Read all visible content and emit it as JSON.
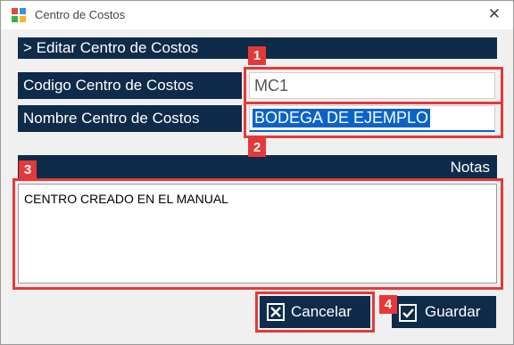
{
  "window": {
    "title": "Centro de Costos",
    "close_icon": "close-icon"
  },
  "section": {
    "header": "> Editar Centro de Costos"
  },
  "form": {
    "codigo_label": "Codigo Centro de Costos",
    "codigo_value": "MC1",
    "nombre_label": "Nombre Centro de Costos",
    "nombre_value": "BODEGA DE EJEMPLO"
  },
  "notes": {
    "label": "Notas",
    "value": "CENTRO CREADO EN EL MANUAL"
  },
  "buttons": {
    "cancel": "Cancelar",
    "save": "Guardar"
  },
  "annotations": [
    "1",
    "2",
    "3",
    "4"
  ],
  "colors": {
    "accent": "#0f2b4a",
    "highlight": "#e53939",
    "selection": "#0a64c8"
  }
}
